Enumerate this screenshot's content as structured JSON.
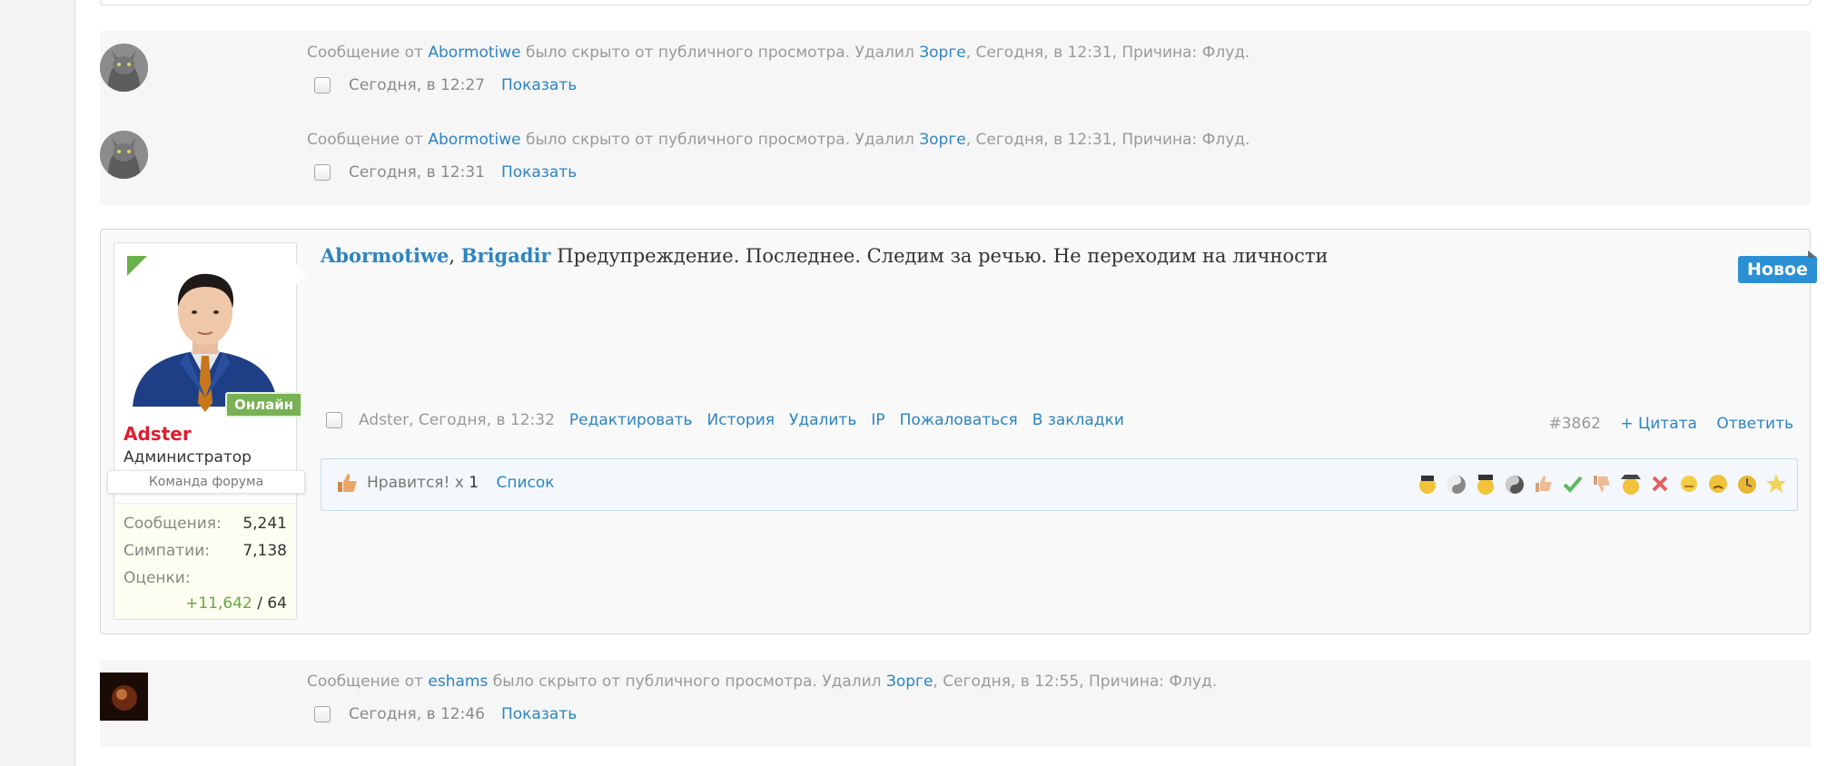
{
  "deleted_posts": [
    {
      "prefix": "Сообщение от",
      "author": "Abormotiwe",
      "middle": "было скрыто от публичного просмотра. Удалил",
      "moderator": "Зорге",
      "suffix": ", Сегодня, в 12:31, Причина: Флуд.",
      "time": "Сегодня, в 12:27",
      "show_label": "Показать"
    },
    {
      "prefix": "Сообщение от",
      "author": "Abormotiwe",
      "middle": "было скрыто от публичного просмотра. Удалил",
      "moderator": "Зорге",
      "suffix": ", Сегодня, в 12:31, Причина: Флуд.",
      "time": "Сегодня, в 12:31",
      "show_label": "Показать"
    },
    {
      "prefix": "Сообщение от",
      "author": "eshams",
      "middle": "было скрыто от публичного просмотра. Удалил",
      "moderator": "Зорге",
      "suffix": ", Сегодня, в 12:55, Причина: Флуд.",
      "time": "Сегодня, в 12:46",
      "show_label": "Показать"
    }
  ],
  "post": {
    "user": {
      "name": "Adster",
      "title": "Администратор",
      "banner": "Команда форума",
      "online": "Онлайн",
      "stats": [
        {
          "label": "Сообщения:",
          "value": "5,241"
        },
        {
          "label": "Симпатии:",
          "value": "7,138"
        },
        {
          "label": "Оценки:",
          "value_positive": "+11,642",
          "value_rest": " / 64"
        }
      ]
    },
    "mentions": [
      "Abormotiwe",
      "Brigadir"
    ],
    "text": "Предупреждение. Последнее. Следим за речью. Не переходим на личности",
    "new_badge": "Новое",
    "meta": {
      "author_time": "Adster, Сегодня, в 12:32",
      "actions": [
        "Редактировать",
        "История",
        "Удалить",
        "IP",
        "Пожаловаться",
        "В закладки"
      ],
      "post_number": "#3862",
      "quote": "+ Цитата",
      "reply": "Ответить"
    },
    "likes": {
      "label": "Нравится!",
      "count_prefix": "x",
      "count": "1",
      "list_label": "Список",
      "reaction_icons": [
        "pirate-icon",
        "yin-yang-icon",
        "pirate-gun-icon",
        "yin-yang-dark-icon",
        "thumbs-up-icon",
        "checkmark-icon",
        "thumbs-down-icon",
        "spy-icon",
        "cross-icon",
        "neutral-face-icon",
        "sad-face-icon",
        "clock-face-icon",
        "star-icon"
      ]
    }
  }
}
